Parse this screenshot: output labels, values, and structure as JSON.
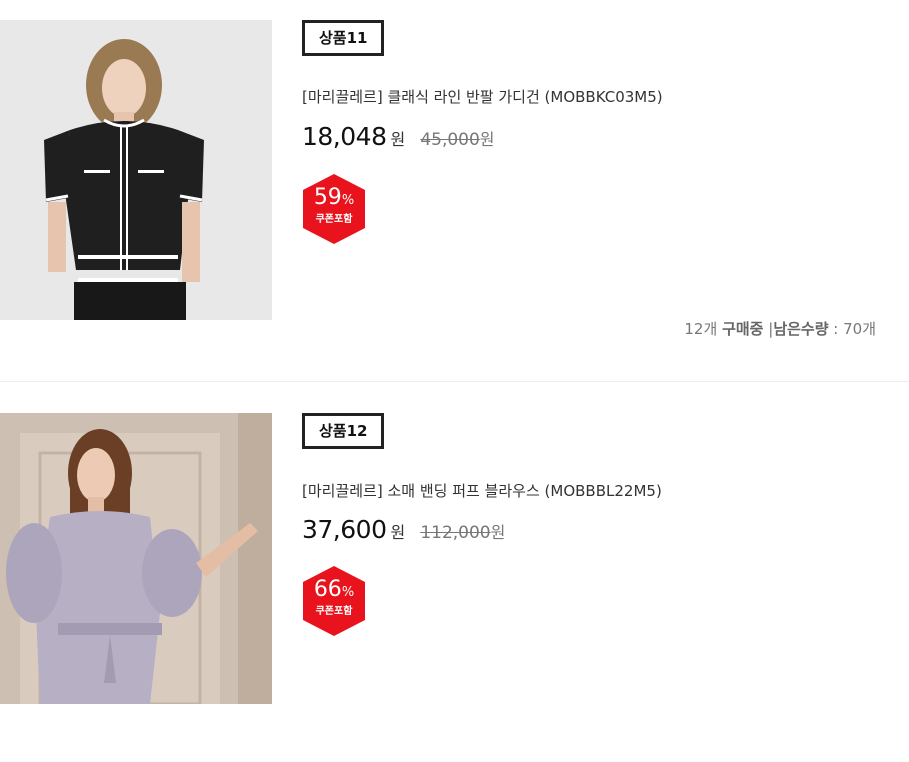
{
  "products": [
    {
      "label": "상품11",
      "title": "[마리끌레르] 클래식 라인 반팔 가디건 (MOBBKC03M5)",
      "price": "18,048",
      "price_unit": "원",
      "original_price": "45,000",
      "original_unit": "원",
      "discount_number": "59",
      "discount_percent_sign": "%",
      "discount_note": "쿠폰포함",
      "sold_count": "12개",
      "sold_label": "구매중",
      "separator": "|",
      "remaining_label": "남은수량",
      "remaining_colon": " : ",
      "remaining_count": "70개"
    },
    {
      "label": "상품12",
      "title": "[마리끌레르] 소매 밴딩 퍼프 블라우스 (MOBBBL22M5)",
      "price": "37,600",
      "price_unit": "원",
      "original_price": "112,000",
      "original_unit": "원",
      "discount_number": "66",
      "discount_percent_sign": "%",
      "discount_note": "쿠폰포함"
    }
  ],
  "colors": {
    "badge_red": "#e8131c",
    "label_border": "#222222",
    "divider": "#ececec"
  }
}
